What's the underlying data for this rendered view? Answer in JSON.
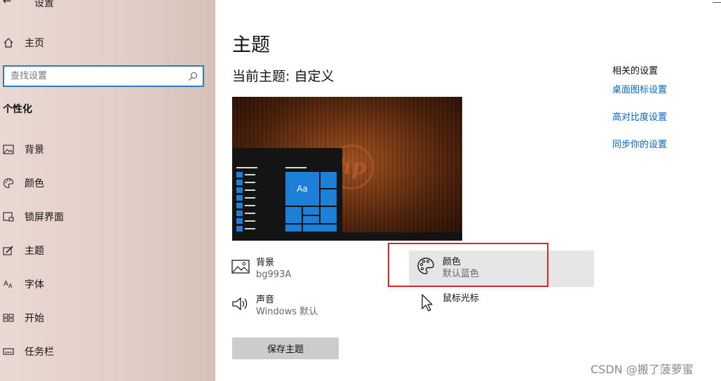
{
  "sidebar": {
    "title": "设置",
    "home_label": "主页",
    "search_placeholder": "查找设置",
    "section_header": "个性化",
    "items": [
      {
        "label": "背景",
        "icon": "image-icon"
      },
      {
        "label": "颜色",
        "icon": "palette-icon"
      },
      {
        "label": "锁屏界面",
        "icon": "lock-screen-icon"
      },
      {
        "label": "主题",
        "icon": "theme-brush-icon"
      },
      {
        "label": "字体",
        "icon": "font-icon"
      },
      {
        "label": "开始",
        "icon": "start-grid-icon"
      },
      {
        "label": "任务栏",
        "icon": "taskbar-icon"
      }
    ]
  },
  "main": {
    "title": "主题",
    "current_theme": "当前主题: 自定义",
    "preview": {
      "tile_label": "Aa",
      "wallpaper_logo": "hp"
    },
    "options": {
      "background": {
        "label": "背景",
        "value": "bg993A"
      },
      "color": {
        "label": "颜色",
        "value": "默认蓝色"
      },
      "sound": {
        "label": "声音",
        "value": "Windows 默认"
      },
      "cursor": {
        "label": "鼠标光标",
        "value": ""
      }
    },
    "save_button": "保存主题"
  },
  "related": {
    "title": "相关的设置",
    "links": [
      "桌面图标设置",
      "高对比度设置",
      "同步你的设置"
    ]
  },
  "watermark": "CSDN @搬了菠萝蜜",
  "colors": {
    "accent": "#0067c0",
    "tile_blue": "#1c7fd8",
    "highlight_box": "#d7262a",
    "search_border": "#2f78c4"
  }
}
